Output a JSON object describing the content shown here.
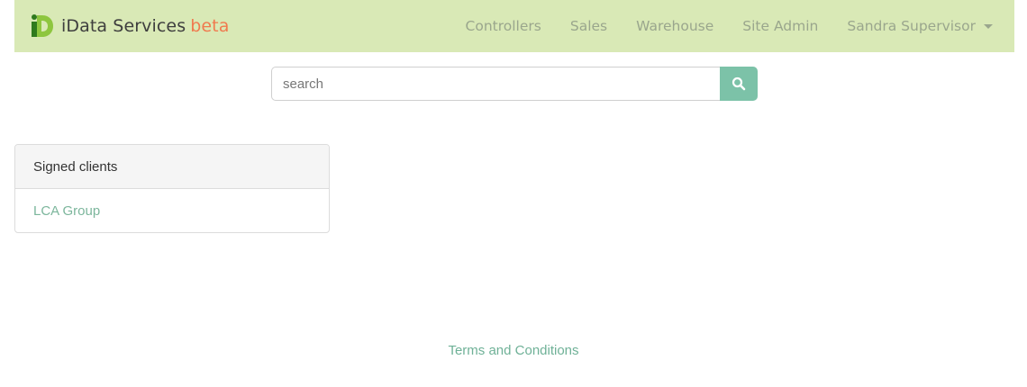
{
  "brand": {
    "name": "iData Services",
    "tag": "beta",
    "logo_icon": "idata-logo-icon",
    "colors": {
      "logo_dark": "#2f7a1e",
      "logo_light": "#8ec63f",
      "tag": "#f07a4f"
    }
  },
  "nav": {
    "items": [
      {
        "label": "Controllers"
      },
      {
        "label": "Sales"
      },
      {
        "label": "Warehouse"
      },
      {
        "label": "Site Admin"
      }
    ],
    "user": {
      "label": "Sandra Supervisor",
      "icon": "caret-down-icon"
    },
    "background": "#d9e9b6"
  },
  "search": {
    "placeholder": "search",
    "value": "",
    "button_icon": "search-icon",
    "button_color": "#7cc2a8"
  },
  "panel": {
    "heading": "Signed clients",
    "clients": [
      {
        "name": "LCA Group"
      }
    ]
  },
  "footer": {
    "terms_label": "Terms and Conditions"
  }
}
